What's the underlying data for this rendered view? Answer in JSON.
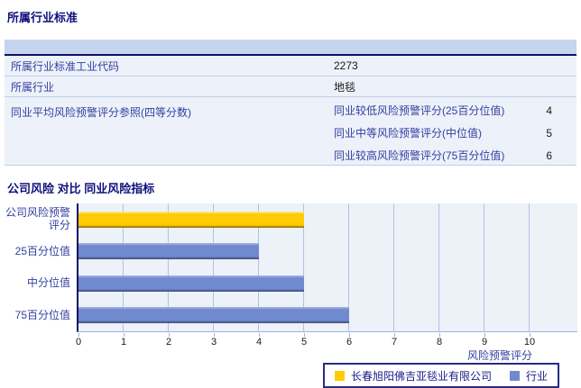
{
  "industry_section": {
    "title": "所属行业标准",
    "rows": [
      {
        "label": "所属行业标准工业代码",
        "value": "2273"
      },
      {
        "label": "所属行业",
        "value": "地毯"
      },
      {
        "label": "同业平均风险预警评分参照(四等分数)",
        "sub_rows": [
          {
            "label": "同业较低风险预警评分(25百分位值)",
            "value": "4"
          },
          {
            "label": "同业中等风险预警评分(中位值)",
            "value": "5"
          },
          {
            "label": "同业较高风险预警评分(75百分位值)",
            "value": "6"
          }
        ]
      }
    ]
  },
  "comparison_section": {
    "title": "公司风险 对比 同业风险指标"
  },
  "chart_data": {
    "type": "bar",
    "orientation": "horizontal",
    "categories": [
      "公司风险预警评分",
      "25百分位值",
      "中分位值",
      "75百分位值"
    ],
    "bar_values": [
      5,
      4,
      5,
      6
    ],
    "bar_series": [
      "company",
      "industry",
      "industry",
      "industry"
    ],
    "series": [
      {
        "name": "长春旭阳佛吉亚毯业有限公司",
        "color": "#FFCC00",
        "values": [
          5,
          null,
          null,
          null
        ]
      },
      {
        "name": "行业",
        "color": "#7189CE",
        "values": [
          null,
          4,
          5,
          6
        ]
      }
    ],
    "xlabel": "风险预警评分",
    "xlim": [
      0,
      10
    ],
    "xticks": [
      0,
      1,
      2,
      3,
      4,
      5,
      6,
      7,
      8,
      9,
      10
    ],
    "grid": true,
    "legend_position": "bottom-right"
  },
  "colors": {
    "section_title": "#10107E",
    "table_header_bg": "#C6D5EE",
    "table_row_bg": "#EDF1F9",
    "table_label_text": "#3340A0",
    "table_value_text": "#1A1A1A",
    "header_border": "#10106A",
    "plot_bg": "#EDF1F8",
    "gridline": "#B3C2E4",
    "company_bar": "#FFCC00",
    "industry_bar": "#7189CE",
    "legend_border": "#2A2A85"
  }
}
